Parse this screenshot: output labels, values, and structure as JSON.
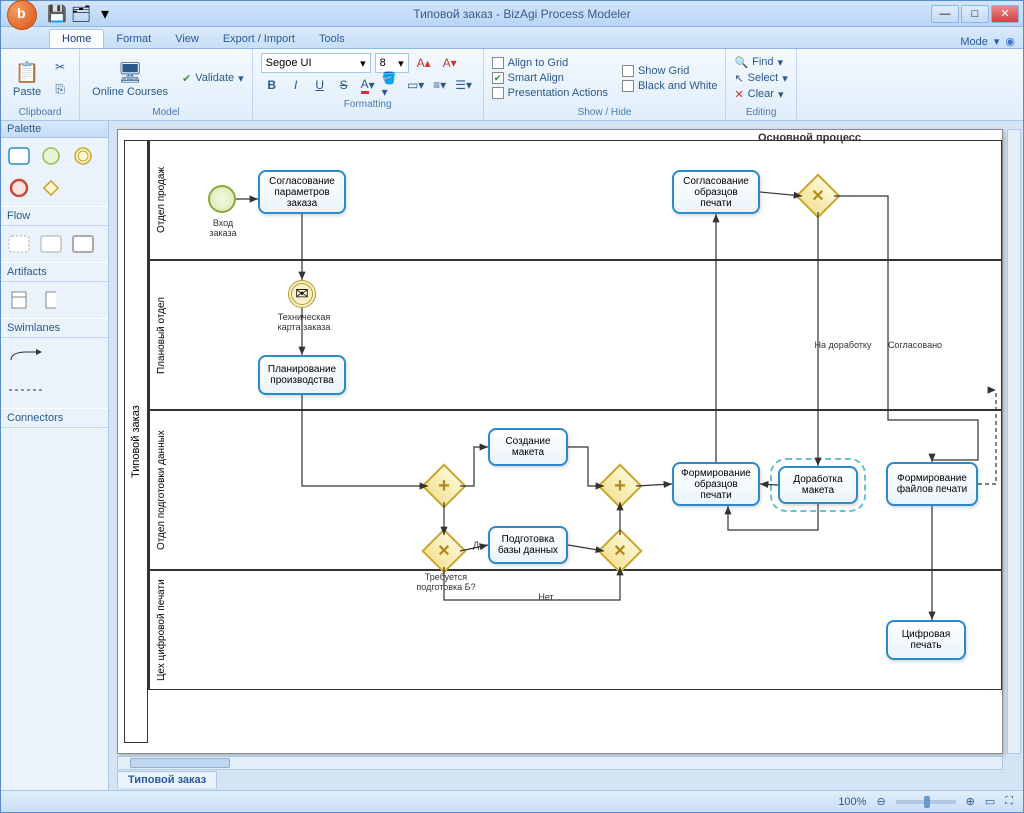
{
  "window": {
    "title": "Типовой заказ - BizAgi Process Modeler"
  },
  "tabs": {
    "home": "Home",
    "format": "Format",
    "view": "View",
    "export": "Export / Import",
    "tools": "Tools",
    "mode": "Mode"
  },
  "ribbon": {
    "clipboard": {
      "paste": "Paste",
      "label": "Clipboard"
    },
    "model": {
      "courses": "Online Courses",
      "validate": "Validate",
      "label": "Model"
    },
    "formatting": {
      "font": "Segoe UI",
      "size": "8",
      "label": "Formatting"
    },
    "showhide": {
      "alignGrid": "Align to Grid",
      "smartAlign": "Smart Align",
      "presentation": "Presentation Actions",
      "showGrid": "Show Grid",
      "bw": "Black and White",
      "label": "Show / Hide"
    },
    "editing": {
      "find": "Find",
      "select": "Select",
      "clear": "Clear",
      "label": "Editing"
    }
  },
  "palette": {
    "title": "Palette",
    "flow": "Flow",
    "artifacts": "Artifacts",
    "swimlanes": "Swimlanes",
    "connectors": "Connectors"
  },
  "doc": {
    "tab": "Типовой заказ"
  },
  "status": {
    "zoom": "100%"
  },
  "diagram": {
    "pool": "Типовой заказ",
    "title": "Основной процесс",
    "lanes": {
      "l1": "Отдел продаж",
      "l2": "Плановый отдел",
      "l3": "Отдел подготовки данных",
      "l4": "Цех цифровой печати"
    },
    "tasks": {
      "t1": "Согласование параметров заказа",
      "t2": "Планирование производства",
      "t3": "Создание макета",
      "t4": "Подготовка базы данных",
      "t5": "Формирование образцов печати",
      "t6": "Доработка макета",
      "t7": "Согласование образцов печати",
      "t8": "Формирование файлов печати",
      "t9": "Цифровая печать"
    },
    "labels": {
      "start": "Вход заказа",
      "msg": "Техническая карта заказа",
      "q1": "Требуется подготовка Б?",
      "da": "Д",
      "net": "Нет",
      "rework": "На доработку",
      "approved": "Согласовано"
    }
  }
}
